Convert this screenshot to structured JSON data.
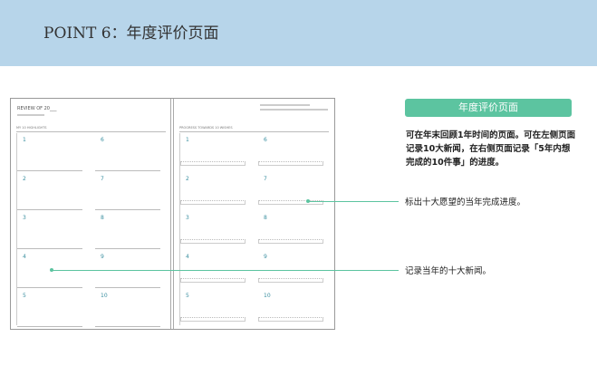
{
  "header": {
    "title": "POINT 6：年度评价页面"
  },
  "planner": {
    "left": {
      "heading": "REVIEW OF 20___",
      "section": "MY 10 HIGHLIGHTS",
      "numbers": [
        "1",
        "2",
        "3",
        "4",
        "5",
        "6",
        "7",
        "8",
        "9",
        "10"
      ]
    },
    "right": {
      "section": "PROGRESS TOWARDS 10 WISHES",
      "numbers": [
        "1",
        "2",
        "3",
        "4",
        "5",
        "6",
        "7",
        "8",
        "9",
        "10"
      ]
    }
  },
  "info": {
    "badge": "年度评价页面",
    "description": "可在年末回顾1年时间的页面。可在左侧页面记录10大新闻，在右侧页面记录「5年内想完成的10件事」的进度。",
    "callout_progress": "标出十大愿望的当年完成进度。",
    "callout_news": "记录当年的十大新闻。"
  },
  "colors": {
    "accent": "#5cc4a0",
    "header_bg": "#b7d5ea"
  }
}
